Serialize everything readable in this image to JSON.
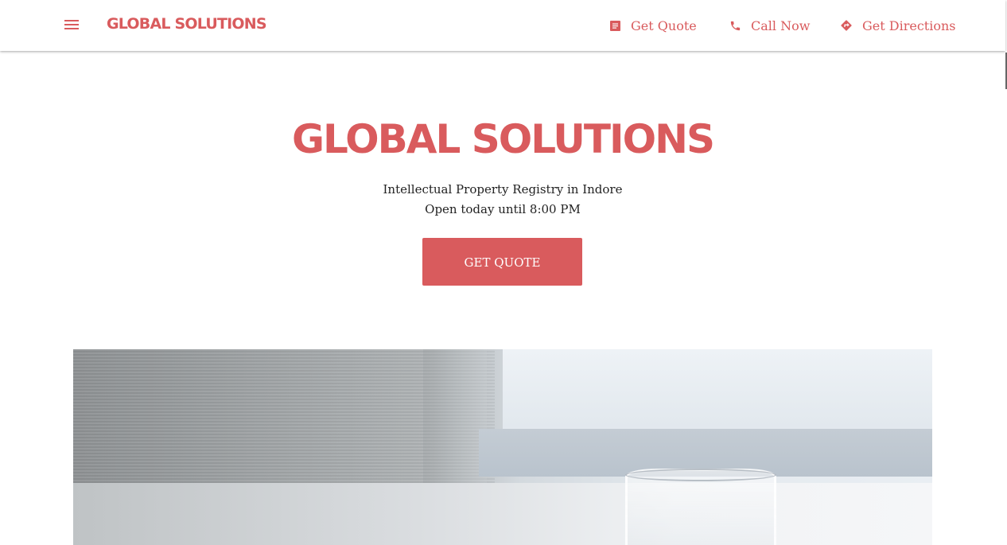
{
  "header": {
    "brand": "GLOBAL SOLUTIONS",
    "nav": [
      {
        "label": "Get Quote",
        "icon": "document-icon"
      },
      {
        "label": "Call Now",
        "icon": "phone-icon"
      },
      {
        "label": "Get Directions",
        "icon": "directions-icon"
      }
    ]
  },
  "hero": {
    "title": "GLOBAL SOLUTIONS",
    "category": "Intellectual Property Registry in Indore",
    "hours": "Open today until 8:00 PM",
    "cta_label": "GET QUOTE"
  },
  "colors": {
    "accent": "#d95b5d",
    "text": "#222222",
    "background": "#ffffff"
  }
}
